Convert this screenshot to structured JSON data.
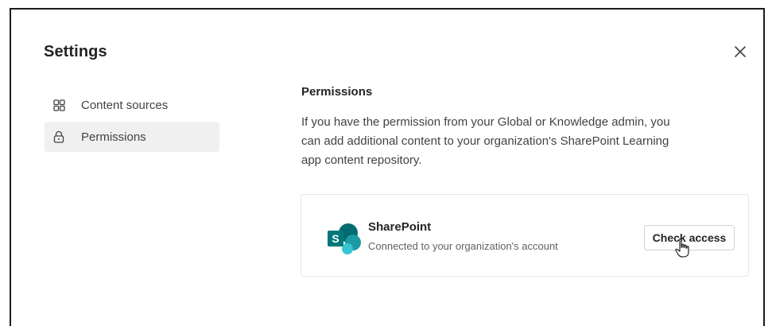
{
  "dialog": {
    "title": "Settings",
    "close_icon": "close-icon"
  },
  "sidebar": {
    "items": [
      {
        "label": "Content sources",
        "icon": "grid-icon",
        "selected": false
      },
      {
        "label": "Permissions",
        "icon": "lock-icon",
        "selected": true
      }
    ]
  },
  "main": {
    "section_title": "Permissions",
    "description": "If you have the permission from your Global or Knowledge admin, you can add additional content to your organization's SharePoint Learning app content repository.",
    "card": {
      "app_name": "SharePoint",
      "status": "Connected to your organization's account",
      "button_label": "Check access",
      "logo_icon": "sharepoint-logo-icon",
      "logo_letter": "S"
    }
  },
  "colors": {
    "sharepoint_dark": "#036c70",
    "sharepoint_mid": "#1a9ba1",
    "sharepoint_light": "#37c6d0",
    "selected_bg": "#f0f0f0"
  }
}
